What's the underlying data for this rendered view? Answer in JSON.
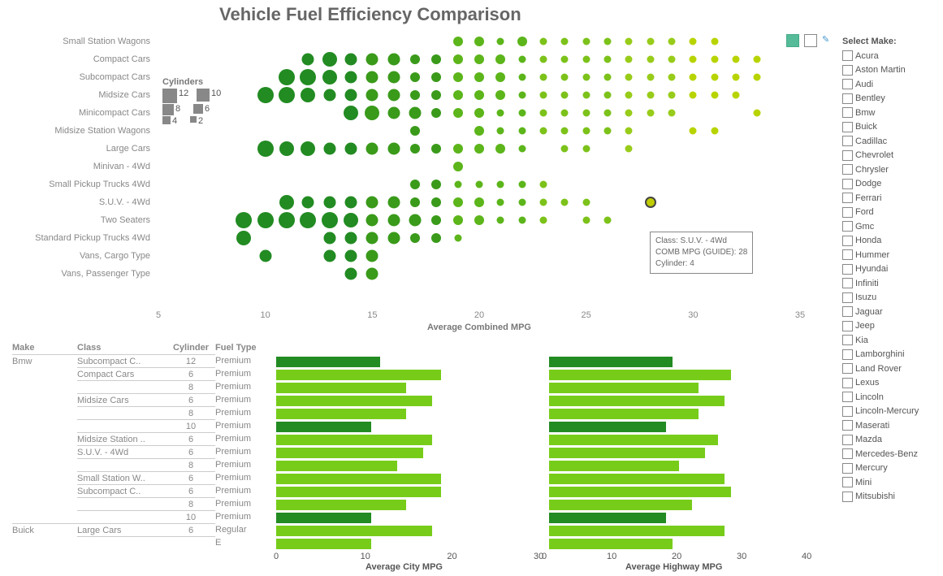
{
  "title": "Vehicle Fuel Efficiency Comparison",
  "chart_data": {
    "scatter": {
      "type": "scatter",
      "title": "Vehicle Fuel Efficiency Comparison",
      "xlabel": "Average Combined MPG",
      "ylabel": "",
      "xlim": [
        5,
        35
      ],
      "categories": [
        "Small Station Wagons",
        "Compact Cars",
        "Subcompact Cars",
        "Midsize Cars",
        "Minicompact Cars",
        "Midsize Station Wagons",
        "Large Cars",
        "Minivan - 4Wd",
        "Small Pickup Trucks 4Wd",
        "S.U.V. - 4Wd",
        "Two Seaters",
        "Standard Pickup Trucks 4Wd",
        "Vans, Cargo Type",
        "Vans, Passenger Type"
      ],
      "legend": {
        "title": "Cylinders",
        "items": [
          {
            "n": "12",
            "s": 12
          },
          {
            "n": "10",
            "s": 10
          },
          {
            "n": "8",
            "s": 8
          },
          {
            "n": "6",
            "s": 6
          },
          {
            "n": "4",
            "s": 4
          },
          {
            "n": "2",
            "s": 2
          }
        ]
      },
      "points": [
        {
          "row": 0,
          "mpg": 19,
          "c": 6
        },
        {
          "row": 0,
          "mpg": 20,
          "c": 6
        },
        {
          "row": 0,
          "mpg": 21,
          "c": 4
        },
        {
          "row": 0,
          "mpg": 22,
          "c": 6
        },
        {
          "row": 0,
          "mpg": 23,
          "c": 4
        },
        {
          "row": 0,
          "mpg": 24,
          "c": 4
        },
        {
          "row": 0,
          "mpg": 25,
          "c": 4
        },
        {
          "row": 0,
          "mpg": 26,
          "c": 4
        },
        {
          "row": 0,
          "mpg": 27,
          "c": 4
        },
        {
          "row": 0,
          "mpg": 28,
          "c": 4
        },
        {
          "row": 0,
          "mpg": 29,
          "c": 4
        },
        {
          "row": 0,
          "mpg": 30,
          "c": 4
        },
        {
          "row": 0,
          "mpg": 31,
          "c": 4
        },
        {
          "row": 1,
          "mpg": 12,
          "c": 8
        },
        {
          "row": 1,
          "mpg": 13,
          "c": 10
        },
        {
          "row": 1,
          "mpg": 14,
          "c": 8
        },
        {
          "row": 1,
          "mpg": 15,
          "c": 8
        },
        {
          "row": 1,
          "mpg": 16,
          "c": 8
        },
        {
          "row": 1,
          "mpg": 17,
          "c": 6
        },
        {
          "row": 1,
          "mpg": 18,
          "c": 6
        },
        {
          "row": 1,
          "mpg": 19,
          "c": 6
        },
        {
          "row": 1,
          "mpg": 20,
          "c": 6
        },
        {
          "row": 1,
          "mpg": 21,
          "c": 6
        },
        {
          "row": 1,
          "mpg": 22,
          "c": 4
        },
        {
          "row": 1,
          "mpg": 23,
          "c": 4
        },
        {
          "row": 1,
          "mpg": 24,
          "c": 4
        },
        {
          "row": 1,
          "mpg": 25,
          "c": 4
        },
        {
          "row": 1,
          "mpg": 26,
          "c": 4
        },
        {
          "row": 1,
          "mpg": 27,
          "c": 4
        },
        {
          "row": 1,
          "mpg": 28,
          "c": 4
        },
        {
          "row": 1,
          "mpg": 29,
          "c": 4
        },
        {
          "row": 1,
          "mpg": 30,
          "c": 4
        },
        {
          "row": 1,
          "mpg": 31,
          "c": 4
        },
        {
          "row": 1,
          "mpg": 32,
          "c": 4
        },
        {
          "row": 1,
          "mpg": 33,
          "c": 4
        },
        {
          "row": 2,
          "mpg": 11,
          "c": 12
        },
        {
          "row": 2,
          "mpg": 12,
          "c": 12
        },
        {
          "row": 2,
          "mpg": 13,
          "c": 10
        },
        {
          "row": 2,
          "mpg": 14,
          "c": 8
        },
        {
          "row": 2,
          "mpg": 15,
          "c": 8
        },
        {
          "row": 2,
          "mpg": 16,
          "c": 8
        },
        {
          "row": 2,
          "mpg": 17,
          "c": 6
        },
        {
          "row": 2,
          "mpg": 18,
          "c": 6
        },
        {
          "row": 2,
          "mpg": 19,
          "c": 6
        },
        {
          "row": 2,
          "mpg": 20,
          "c": 6
        },
        {
          "row": 2,
          "mpg": 21,
          "c": 6
        },
        {
          "row": 2,
          "mpg": 22,
          "c": 4
        },
        {
          "row": 2,
          "mpg": 23,
          "c": 4
        },
        {
          "row": 2,
          "mpg": 24,
          "c": 4
        },
        {
          "row": 2,
          "mpg": 25,
          "c": 4
        },
        {
          "row": 2,
          "mpg": 26,
          "c": 4
        },
        {
          "row": 2,
          "mpg": 27,
          "c": 4
        },
        {
          "row": 2,
          "mpg": 28,
          "c": 4
        },
        {
          "row": 2,
          "mpg": 29,
          "c": 4
        },
        {
          "row": 2,
          "mpg": 30,
          "c": 4
        },
        {
          "row": 2,
          "mpg": 31,
          "c": 4
        },
        {
          "row": 2,
          "mpg": 32,
          "c": 4
        },
        {
          "row": 2,
          "mpg": 33,
          "c": 4
        },
        {
          "row": 3,
          "mpg": 10,
          "c": 12
        },
        {
          "row": 3,
          "mpg": 11,
          "c": 12
        },
        {
          "row": 3,
          "mpg": 12,
          "c": 10
        },
        {
          "row": 3,
          "mpg": 13,
          "c": 8
        },
        {
          "row": 3,
          "mpg": 14,
          "c": 8
        },
        {
          "row": 3,
          "mpg": 15,
          "c": 8
        },
        {
          "row": 3,
          "mpg": 16,
          "c": 8
        },
        {
          "row": 3,
          "mpg": 17,
          "c": 6
        },
        {
          "row": 3,
          "mpg": 18,
          "c": 6
        },
        {
          "row": 3,
          "mpg": 19,
          "c": 6
        },
        {
          "row": 3,
          "mpg": 20,
          "c": 6
        },
        {
          "row": 3,
          "mpg": 21,
          "c": 6
        },
        {
          "row": 3,
          "mpg": 22,
          "c": 4
        },
        {
          "row": 3,
          "mpg": 23,
          "c": 4
        },
        {
          "row": 3,
          "mpg": 24,
          "c": 4
        },
        {
          "row": 3,
          "mpg": 25,
          "c": 4
        },
        {
          "row": 3,
          "mpg": 26,
          "c": 4
        },
        {
          "row": 3,
          "mpg": 27,
          "c": 4
        },
        {
          "row": 3,
          "mpg": 28,
          "c": 4
        },
        {
          "row": 3,
          "mpg": 29,
          "c": 4
        },
        {
          "row": 3,
          "mpg": 30,
          "c": 4
        },
        {
          "row": 3,
          "mpg": 31,
          "c": 4
        },
        {
          "row": 3,
          "mpg": 32,
          "c": 4
        },
        {
          "row": 4,
          "mpg": 14,
          "c": 10
        },
        {
          "row": 4,
          "mpg": 15,
          "c": 10
        },
        {
          "row": 4,
          "mpg": 16,
          "c": 8
        },
        {
          "row": 4,
          "mpg": 17,
          "c": 8
        },
        {
          "row": 4,
          "mpg": 18,
          "c": 6
        },
        {
          "row": 4,
          "mpg": 19,
          "c": 6
        },
        {
          "row": 4,
          "mpg": 20,
          "c": 6
        },
        {
          "row": 4,
          "mpg": 21,
          "c": 4
        },
        {
          "row": 4,
          "mpg": 22,
          "c": 4
        },
        {
          "row": 4,
          "mpg": 23,
          "c": 4
        },
        {
          "row": 4,
          "mpg": 24,
          "c": 4
        },
        {
          "row": 4,
          "mpg": 25,
          "c": 4
        },
        {
          "row": 4,
          "mpg": 26,
          "c": 4
        },
        {
          "row": 4,
          "mpg": 27,
          "c": 4
        },
        {
          "row": 4,
          "mpg": 28,
          "c": 4
        },
        {
          "row": 4,
          "mpg": 29,
          "c": 4
        },
        {
          "row": 4,
          "mpg": 33,
          "c": 4
        },
        {
          "row": 5,
          "mpg": 17,
          "c": 6
        },
        {
          "row": 5,
          "mpg": 20,
          "c": 6
        },
        {
          "row": 5,
          "mpg": 21,
          "c": 4
        },
        {
          "row": 5,
          "mpg": 22,
          "c": 4
        },
        {
          "row": 5,
          "mpg": 23,
          "c": 4
        },
        {
          "row": 5,
          "mpg": 24,
          "c": 4
        },
        {
          "row": 5,
          "mpg": 25,
          "c": 4
        },
        {
          "row": 5,
          "mpg": 26,
          "c": 4
        },
        {
          "row": 5,
          "mpg": 27,
          "c": 4
        },
        {
          "row": 5,
          "mpg": 30,
          "c": 4
        },
        {
          "row": 5,
          "mpg": 31,
          "c": 4
        },
        {
          "row": 6,
          "mpg": 10,
          "c": 12
        },
        {
          "row": 6,
          "mpg": 11,
          "c": 10
        },
        {
          "row": 6,
          "mpg": 12,
          "c": 10
        },
        {
          "row": 6,
          "mpg": 13,
          "c": 8
        },
        {
          "row": 6,
          "mpg": 14,
          "c": 8
        },
        {
          "row": 6,
          "mpg": 15,
          "c": 8
        },
        {
          "row": 6,
          "mpg": 16,
          "c": 8
        },
        {
          "row": 6,
          "mpg": 17,
          "c": 6
        },
        {
          "row": 6,
          "mpg": 18,
          "c": 6
        },
        {
          "row": 6,
          "mpg": 19,
          "c": 6
        },
        {
          "row": 6,
          "mpg": 20,
          "c": 6
        },
        {
          "row": 6,
          "mpg": 21,
          "c": 6
        },
        {
          "row": 6,
          "mpg": 22,
          "c": 4
        },
        {
          "row": 6,
          "mpg": 24,
          "c": 4
        },
        {
          "row": 6,
          "mpg": 25,
          "c": 4
        },
        {
          "row": 6,
          "mpg": 27,
          "c": 4
        },
        {
          "row": 7,
          "mpg": 19,
          "c": 6
        },
        {
          "row": 8,
          "mpg": 17,
          "c": 6
        },
        {
          "row": 8,
          "mpg": 18,
          "c": 6
        },
        {
          "row": 8,
          "mpg": 19,
          "c": 4
        },
        {
          "row": 8,
          "mpg": 20,
          "c": 4
        },
        {
          "row": 8,
          "mpg": 21,
          "c": 4
        },
        {
          "row": 8,
          "mpg": 22,
          "c": 4
        },
        {
          "row": 8,
          "mpg": 23,
          "c": 4
        },
        {
          "row": 9,
          "mpg": 11,
          "c": 10
        },
        {
          "row": 9,
          "mpg": 12,
          "c": 8
        },
        {
          "row": 9,
          "mpg": 13,
          "c": 8
        },
        {
          "row": 9,
          "mpg": 14,
          "c": 8
        },
        {
          "row": 9,
          "mpg": 15,
          "c": 8
        },
        {
          "row": 9,
          "mpg": 16,
          "c": 8
        },
        {
          "row": 9,
          "mpg": 17,
          "c": 6
        },
        {
          "row": 9,
          "mpg": 18,
          "c": 6
        },
        {
          "row": 9,
          "mpg": 19,
          "c": 6
        },
        {
          "row": 9,
          "mpg": 20,
          "c": 6
        },
        {
          "row": 9,
          "mpg": 21,
          "c": 4
        },
        {
          "row": 9,
          "mpg": 22,
          "c": 4
        },
        {
          "row": 9,
          "mpg": 23,
          "c": 4
        },
        {
          "row": 9,
          "mpg": 24,
          "c": 4
        },
        {
          "row": 9,
          "mpg": 25,
          "c": 4
        },
        {
          "row": 10,
          "mpg": 9,
          "c": 12
        },
        {
          "row": 10,
          "mpg": 10,
          "c": 12
        },
        {
          "row": 10,
          "mpg": 11,
          "c": 12
        },
        {
          "row": 10,
          "mpg": 12,
          "c": 12
        },
        {
          "row": 10,
          "mpg": 13,
          "c": 12
        },
        {
          "row": 10,
          "mpg": 14,
          "c": 10
        },
        {
          "row": 10,
          "mpg": 15,
          "c": 8
        },
        {
          "row": 10,
          "mpg": 16,
          "c": 8
        },
        {
          "row": 10,
          "mpg": 17,
          "c": 8
        },
        {
          "row": 10,
          "mpg": 18,
          "c": 6
        },
        {
          "row": 10,
          "mpg": 19,
          "c": 6
        },
        {
          "row": 10,
          "mpg": 20,
          "c": 6
        },
        {
          "row": 10,
          "mpg": 21,
          "c": 4
        },
        {
          "row": 10,
          "mpg": 22,
          "c": 4
        },
        {
          "row": 10,
          "mpg": 23,
          "c": 4
        },
        {
          "row": 10,
          "mpg": 25,
          "c": 4
        },
        {
          "row": 10,
          "mpg": 26,
          "c": 4
        },
        {
          "row": 11,
          "mpg": 9,
          "c": 10
        },
        {
          "row": 11,
          "mpg": 13,
          "c": 8
        },
        {
          "row": 11,
          "mpg": 14,
          "c": 8
        },
        {
          "row": 11,
          "mpg": 15,
          "c": 8
        },
        {
          "row": 11,
          "mpg": 16,
          "c": 8
        },
        {
          "row": 11,
          "mpg": 17,
          "c": 6
        },
        {
          "row": 11,
          "mpg": 18,
          "c": 6
        },
        {
          "row": 11,
          "mpg": 19,
          "c": 4
        },
        {
          "row": 12,
          "mpg": 10,
          "c": 8
        },
        {
          "row": 12,
          "mpg": 13,
          "c": 8
        },
        {
          "row": 12,
          "mpg": 14,
          "c": 8
        },
        {
          "row": 12,
          "mpg": 15,
          "c": 8
        },
        {
          "row": 13,
          "mpg": 14,
          "c": 8
        },
        {
          "row": 13,
          "mpg": 15,
          "c": 8
        }
      ],
      "xticks": [
        5,
        10,
        15,
        20,
        25,
        30,
        35
      ],
      "tooltip": {
        "l1": "Class: S.U.V. - 4Wd",
        "l2": "COMB MPG (GUIDE): 28",
        "l3": "Cylinder: 4"
      },
      "highlight": {
        "row": 9,
        "mpg": 28
      }
    },
    "bars": {
      "type": "bar",
      "xlabel_city": "Average City MPG",
      "xlabel_hwy": "Average Highway MPG",
      "xlim": [
        0,
        30
      ],
      "xlim_h": [
        0,
        40
      ],
      "xticks": [
        0,
        10,
        20,
        30
      ],
      "xticks_h": [
        0,
        10,
        20,
        30,
        40
      ],
      "headers": {
        "make": "Make",
        "class": "Class",
        "cyl": "Cylinder",
        "ft": "Fuel Type"
      },
      "rows": [
        {
          "make": "Bmw",
          "class": "Subcompact C..",
          "cyl": "12",
          "ft": "Premium",
          "city": 12,
          "hwy": 19,
          "dark": true
        },
        {
          "make": "",
          "class": "Compact Cars",
          "cyl": "6",
          "ft": "Premium",
          "city": 19,
          "hwy": 28
        },
        {
          "make": "",
          "class": "",
          "cyl": "8",
          "ft": "Premium",
          "city": 15,
          "hwy": 23
        },
        {
          "make": "",
          "class": "Midsize Cars",
          "cyl": "6",
          "ft": "Premium",
          "city": 18,
          "hwy": 27
        },
        {
          "make": "",
          "class": "",
          "cyl": "8",
          "ft": "Premium",
          "city": 15,
          "hwy": 23
        },
        {
          "make": "",
          "class": "",
          "cyl": "10",
          "ft": "Premium",
          "city": 11,
          "hwy": 18,
          "dark": true
        },
        {
          "make": "",
          "class": "Midsize Station ..",
          "cyl": "6",
          "ft": "Premium",
          "city": 18,
          "hwy": 26
        },
        {
          "make": "",
          "class": "S.U.V. - 4Wd",
          "cyl": "6",
          "ft": "Premium",
          "city": 17,
          "hwy": 24
        },
        {
          "make": "",
          "class": "",
          "cyl": "8",
          "ft": "Premium",
          "city": 14,
          "hwy": 20
        },
        {
          "make": "",
          "class": "Small Station W..",
          "cyl": "6",
          "ft": "Premium",
          "city": 19,
          "hwy": 27
        },
        {
          "make": "",
          "class": "Subcompact C..",
          "cyl": "6",
          "ft": "Premium",
          "city": 19,
          "hwy": 28
        },
        {
          "make": "",
          "class": "",
          "cyl": "8",
          "ft": "Premium",
          "city": 15,
          "hwy": 22
        },
        {
          "make": "",
          "class": "",
          "cyl": "10",
          "ft": "Premium",
          "city": 11,
          "hwy": 18,
          "dark": true
        },
        {
          "make": "Buick",
          "class": "Large Cars",
          "cyl": "6",
          "ft": "Regular",
          "city": 18,
          "hwy": 27
        },
        {
          "make": "",
          "class": "",
          "cyl": "",
          "ft": "E",
          "city": 11,
          "hwy": 19
        }
      ]
    }
  },
  "filter": {
    "title": "Select Make:",
    "items": [
      "Acura",
      "Aston Martin",
      "Audi",
      "Bentley",
      "Bmw",
      "Buick",
      "Cadillac",
      "Chevrolet",
      "Chrysler",
      "Dodge",
      "Ferrari",
      "Ford",
      "Gmc",
      "Honda",
      "Hummer",
      "Hyundai",
      "Infiniti",
      "Isuzu",
      "Jaguar",
      "Jeep",
      "Kia",
      "Lamborghini",
      "Land Rover",
      "Lexus",
      "Lincoln",
      "Lincoln-Mercury",
      "Maserati",
      "Mazda",
      "Mercedes-Benz",
      "Mercury",
      "Mini",
      "Mitsubishi"
    ]
  },
  "colors": {
    "c4": "#88cc1a",
    "c6": "#6ab50e",
    "c8": "#3a9a1a",
    "c10": "#228b22",
    "c12": "#176b17",
    "dark_bar": "#228b22",
    "light_bar": "#77cc1a",
    "yellow": "#c0cc00"
  }
}
